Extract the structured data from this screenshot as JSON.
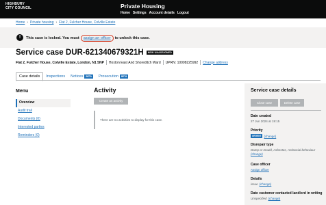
{
  "header": {
    "logo_line1": "HIGHBURY",
    "logo_line2": "CITY COUNCIL",
    "app_name": "Private Housing",
    "nav": [
      "Home",
      "Settings",
      "Account details",
      "Logout"
    ]
  },
  "breadcrumbs": [
    "Home",
    "Private housing",
    "Flat 2, Fulcher House, Colville Estate"
  ],
  "lock_banner": {
    "icon": "!",
    "text_before": "This case is locked. You must",
    "link": "assign an officer",
    "text_after": "to unlock this case."
  },
  "case": {
    "title": "Service case DUR-621340679321H",
    "status_tag": "NEW UNASSIGNED",
    "address": "Flat 2, Fulcher House, Colville Estate, London, N1 5NP",
    "ward": "Hoxton East And Shoreditch Ward",
    "uprn": "UPRN: 10008225992",
    "change_address": "Change address"
  },
  "tabs": [
    {
      "label": "Case details",
      "tag": ""
    },
    {
      "label": "Inspections",
      "tag": ""
    },
    {
      "label": "Notices",
      "tag": "BETA"
    },
    {
      "label": "Prosecution",
      "tag": "BETA"
    }
  ],
  "menu": {
    "heading": "Menu",
    "items": [
      "Overview",
      "Audit trail",
      "Documents (0)",
      "Interested parties",
      "Reminders (0)"
    ]
  },
  "activity": {
    "heading": "Activity",
    "create_button": "Create an activity",
    "empty_message": "There are no activities to display for this case."
  },
  "service_case_details": {
    "heading": "Service case details",
    "close_button": "Close case",
    "delete_button": "Delete case",
    "date_created_label": "Date created",
    "date_created": "27 Jun 2024 at 19:15",
    "priority_label": "Priority",
    "priority_tag": "URGENT",
    "priority_change": "(change)",
    "disrepair_label": "Disrepair type",
    "disrepair_value": "Damp or mould, Asbestos, Antisocial behaviour",
    "disrepair_change": "(change)",
    "officer_label": "Case officer",
    "officer_link": "Assign officer",
    "details_label": "Details",
    "details_value": "issue",
    "details_change": "(change)",
    "landlord_label": "Date customer contacted landlord in writing",
    "landlord_value": "Unspecified",
    "landlord_change": "(change)"
  },
  "colors": {
    "brand_black": "#0b0c0c",
    "link_blue": "#1d70b8",
    "focus_red": "#d4351c",
    "panel_grey": "#f3f2f1"
  }
}
